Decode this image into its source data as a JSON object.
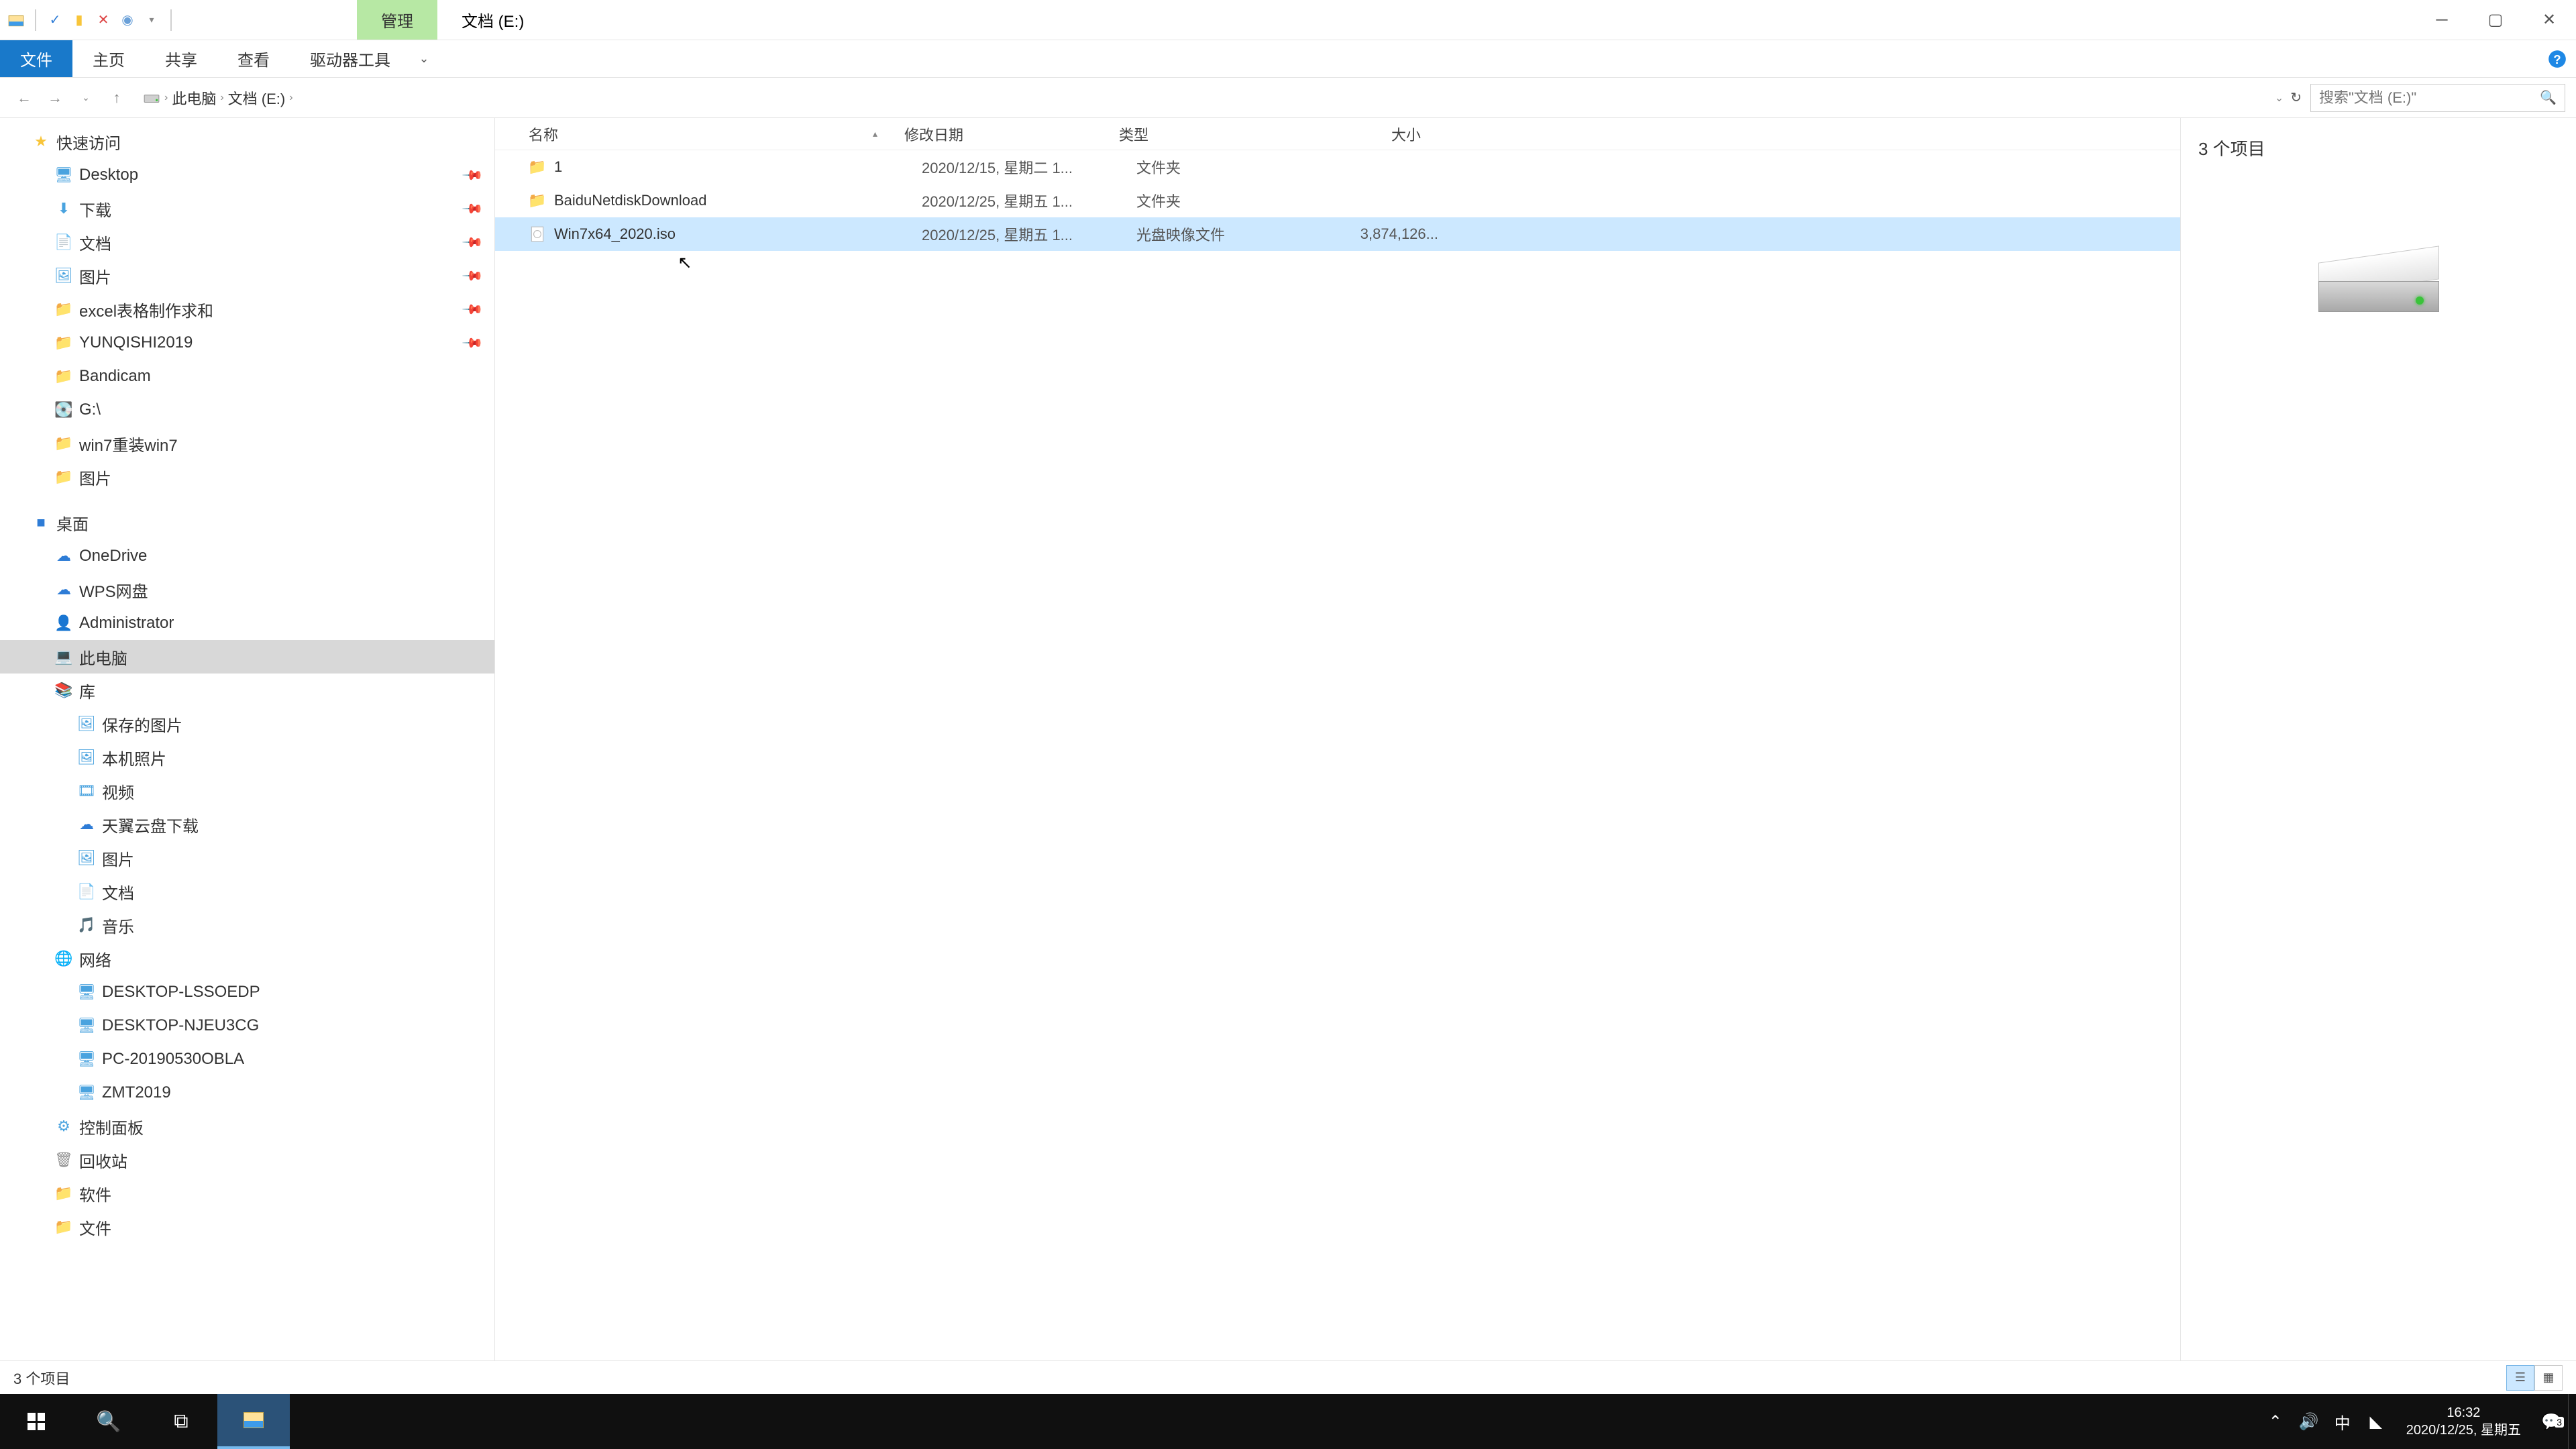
{
  "titlebar": {
    "context_tab": "管理",
    "window_title": "文档 (E:)"
  },
  "ribbon": {
    "file": "文件",
    "home": "主页",
    "share": "共享",
    "view": "查看",
    "drive_tools": "驱动器工具"
  },
  "address": {
    "pc": "此电脑",
    "loc": "文档 (E:)",
    "search_placeholder": "搜索\"文档 (E:)\""
  },
  "nav": {
    "quick_access": "快速访问",
    "desktop": "Desktop",
    "downloads": "下载",
    "documents": "文档",
    "pictures": "图片",
    "excel": "excel表格制作求和",
    "yunqishi": "YUNQISHI2019",
    "bandicam": "Bandicam",
    "g_drive": "G:\\",
    "win7reinstall": "win7重装win7",
    "pictures2": "图片",
    "desktop_zh": "桌面",
    "onedrive": "OneDrive",
    "wps": "WPS网盘",
    "admin": "Administrator",
    "thispc": "此电脑",
    "library": "库",
    "saved_pics": "保存的图片",
    "local_photos": "本机照片",
    "videos": "视频",
    "tianyi": "天翼云盘下载",
    "pics_lib": "图片",
    "docs_lib": "文档",
    "music": "音乐",
    "network": "网络",
    "net1": "DESKTOP-LSSOEDP",
    "net2": "DESKTOP-NJEU3CG",
    "net3": "PC-20190530OBLA",
    "net4": "ZMT2019",
    "control_panel": "控制面板",
    "recycle": "回收站",
    "software": "软件",
    "files": "文件"
  },
  "columns": {
    "name": "名称",
    "modified": "修改日期",
    "type": "类型",
    "size": "大小"
  },
  "files": [
    {
      "icon": "folder",
      "name": "1",
      "date": "2020/12/15, 星期二 1...",
      "type": "文件夹",
      "size": ""
    },
    {
      "icon": "folder",
      "name": "BaiduNetdiskDownload",
      "date": "2020/12/25, 星期五 1...",
      "type": "文件夹",
      "size": ""
    },
    {
      "icon": "iso",
      "name": "Win7x64_2020.iso",
      "date": "2020/12/25, 星期五 1...",
      "type": "光盘映像文件",
      "size": "3,874,126..."
    }
  ],
  "preview": {
    "title": "3 个项目"
  },
  "status": {
    "text": "3 个项目"
  },
  "taskbar": {
    "time": "16:32",
    "date": "2020/12/25, 星期五",
    "ime": "中",
    "notif_count": "3"
  }
}
